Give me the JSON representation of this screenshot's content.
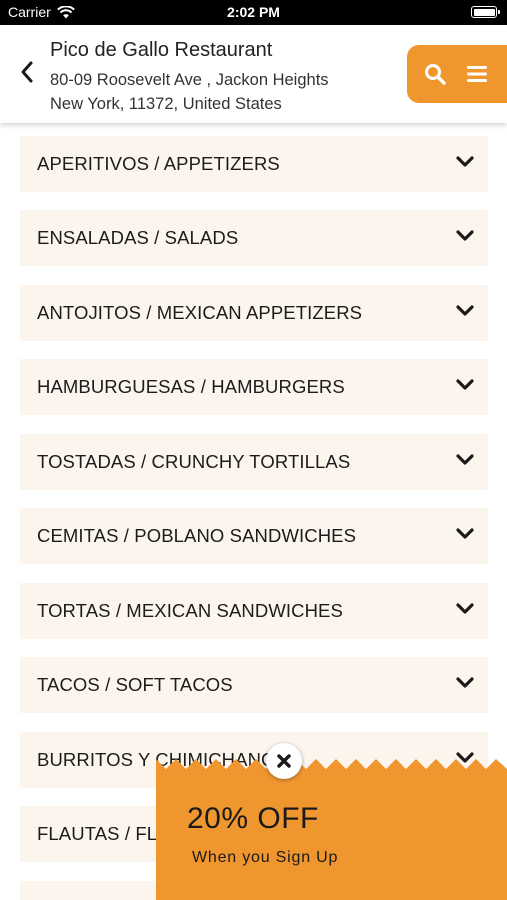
{
  "status_bar": {
    "carrier": "Carrier",
    "time": "2:02 PM"
  },
  "header": {
    "title": "Pico de Gallo Restaurant",
    "address_line1": "80-09 Roosevelt Ave , Jackon Heights",
    "address_line2": "New York, 11372, United States"
  },
  "colors": {
    "accent": "#f0962f",
    "row_bg": "#fcf5ed",
    "text": "#1c1c1c"
  },
  "icons": {
    "back": "chevron-left-icon",
    "search": "search-icon",
    "menu": "hamburger-menu-icon",
    "row": "chevron-down-icon",
    "close": "close-icon"
  },
  "categories": [
    {
      "label": "APERITIVOS / APPETIZERS"
    },
    {
      "label": "ENSALADAS / SALADS"
    },
    {
      "label": "ANTOJITOS / MEXICAN APPETIZERS"
    },
    {
      "label": "HAMBURGUESAS / HAMBURGERS"
    },
    {
      "label": "TOSTADAS / CRUNCHY TORTILLAS"
    },
    {
      "label": "CEMITAS / POBLANO SANDWICHES"
    },
    {
      "label": "TORTAS / MEXICAN SANDWICHES"
    },
    {
      "label": "TACOS / SOFT TACOS"
    },
    {
      "label": "BURRITOS Y CHIMICHANGAS"
    },
    {
      "label": "FLAUTAS / FLAUTAS"
    },
    {
      "label": ""
    }
  ],
  "promo": {
    "headline": "20% OFF",
    "subtext": "When you Sign Up"
  }
}
